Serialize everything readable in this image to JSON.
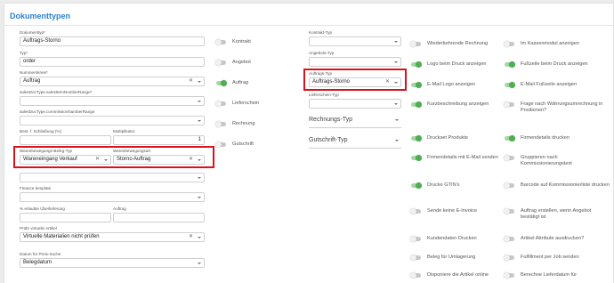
{
  "title": "Dokumenttypen",
  "left": {
    "dokumenttyp": {
      "label": "Dokumenttyp*",
      "value": "Auftrags-Storno"
    },
    "typ": {
      "label": "Typ*",
      "value": "order"
    },
    "nummernkreis": {
      "label": "Nummernkreis*",
      "value": "Auftrag"
    },
    "sales_doc_number_range": {
      "label": "salesDocType.salesItemNumberRange*",
      "value": ""
    },
    "commission_number_range": {
      "label": "salesDocType.commissionNumberRange",
      "value": ""
    },
    "schliessung": {
      "label": "Best. f. Schließung (%)",
      "value": ""
    },
    "multiplikator": {
      "label": "Multiplikator",
      "value": "1"
    },
    "warenbewegung_beleg_typ": {
      "label": "Warenbewegungs-Beleg-Typ",
      "value": "Wareneingang Verkauf"
    },
    "warenbewegungsart": {
      "label": "Warenbewegungsart",
      "value": "Storno Auftrag"
    },
    "finance_template": {
      "label": "Finance template",
      "value": ""
    },
    "ueberlieferung": {
      "label": "% erlaubte Überlieferung",
      "value": ""
    },
    "auftrag": {
      "label": "Auftrag",
      "value": ""
    },
    "pruefe_virtuelle": {
      "label": "Prüfe virtuelle Artikel",
      "value": "Virtuelle Materialien nicht prüfen"
    },
    "datum_suche": {
      "label": "Datum für Preis-Suche",
      "value": "Belegdatum"
    }
  },
  "toggles_mid": [
    {
      "label": "Kontrakt",
      "on": false
    },
    {
      "label": "Angebot",
      "on": false
    },
    {
      "label": "Auftrag",
      "on": true
    },
    {
      "label": "Lieferschein",
      "on": false
    },
    {
      "label": "Rechnung",
      "on": false
    },
    {
      "label": "Gutschrift",
      "on": false
    }
  ],
  "right": {
    "kontrakt_typ": {
      "label": "Kontrakt-Typ",
      "value": ""
    },
    "angebots_typ": {
      "label": "Angebots-Typ",
      "value": ""
    },
    "auftrags_typ": {
      "label": "Auftrags-Typ",
      "value": "Auftrags-Storno"
    },
    "lieferschein_typ": {
      "label": "Lieferschein-Typ",
      "value": ""
    },
    "rechnungs_typ": {
      "placeholder": "Rechnungs-Typ"
    },
    "gutschrift_typ": {
      "placeholder": "Gutschrift-Typ"
    }
  },
  "toggles_a": [
    {
      "label": "Wiederkehrende Rechnung",
      "on": false
    },
    {
      "label": "Logo beim Druck anzeigen",
      "on": true
    },
    {
      "label": "E-Mail Logo anzeigen",
      "on": true
    },
    {
      "label": "Kurzbeschreibung anzeigen",
      "on": true
    },
    {
      "label": "Druckset Produkte",
      "on": true
    },
    {
      "label": "Firmendetails mit E-Mail senden",
      "on": true
    },
    {
      "label": "Drucke GTIN's",
      "on": true
    },
    {
      "label": "Sende keine E-Invoice",
      "on": false
    },
    {
      "label": "Kundendaten Drucken",
      "on": false
    },
    {
      "label": "Beleg für Umlagerung",
      "on": false
    },
    {
      "label": "Disponiere die Artikel online",
      "on": false
    }
  ],
  "toggles_b": [
    {
      "label": "Im Kassenmodul anzeigen",
      "on": false
    },
    {
      "label": "Fußzeile beim Druck anzeigen",
      "on": true
    },
    {
      "label": "E-Mail Fußzeile anzeigen",
      "on": true
    },
    {
      "label": "Frage nach Währungsumrechnung in Positionen?",
      "on": false
    },
    {
      "label": "Firmendetails drucken",
      "on": true
    },
    {
      "label": "Gruppieren nach Kommissionierungstext",
      "on": false
    },
    {
      "label": "Barcode auf Kommissionierliste drucken",
      "on": false
    },
    {
      "label": "Auftrag erstellen, wenn Angebot bestätigt ist",
      "on": false
    },
    {
      "label": "Artikel Attribute ausdrucken?",
      "on": false
    },
    {
      "label": "Fulfillment per Job senden",
      "on": false
    },
    {
      "label": "Berechne Lieferdatum für",
      "on": false
    }
  ],
  "colors": {
    "accent": "#2f80c9",
    "toggle_on": "#4caf50",
    "highlight": "#d9131b"
  }
}
